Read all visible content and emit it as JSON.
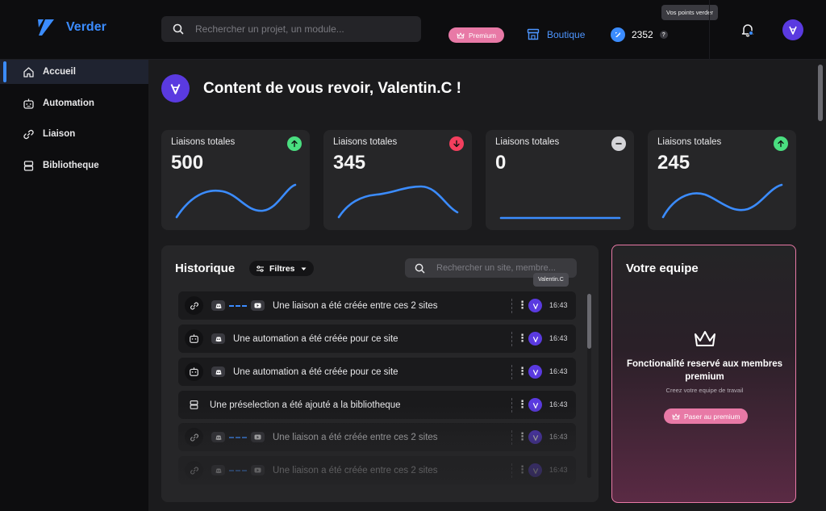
{
  "app": {
    "name": "Verder"
  },
  "header": {
    "search_placeholder": "Rechercher un projet, un module...",
    "premium_label": "Premium",
    "boutique_label": "Boutique",
    "points_value": "2352",
    "points_help": "?",
    "points_tooltip": "Vos points verder"
  },
  "sidebar": {
    "items": [
      {
        "label": "Accueil",
        "icon": "home-icon",
        "active": true
      },
      {
        "label": "Automation",
        "icon": "robot-icon",
        "active": false
      },
      {
        "label": "Liaison",
        "icon": "link-icon",
        "active": false
      },
      {
        "label": "Bibliotheque",
        "icon": "stack-icon",
        "active": false
      }
    ]
  },
  "welcome": {
    "title": "Content de vous revoir, Valentin.C !"
  },
  "cards": [
    {
      "label": "Liaisons totales",
      "value": "500",
      "trend": "up"
    },
    {
      "label": "Liaisons totales",
      "value": "345",
      "trend": "down"
    },
    {
      "label": "Liaisons totales",
      "value": "0",
      "trend": "flat"
    },
    {
      "label": "Liaisons totales",
      "value": "245",
      "trend": "up"
    }
  ],
  "colors": {
    "accent": "#3b8cff",
    "pink": "#e879a6",
    "up": "#4ade80",
    "down": "#f43f5e",
    "flat": "#d4d4d8",
    "avatar": "#5a3ae0"
  },
  "history": {
    "title": "Historique",
    "filter_label": "Filtres",
    "search_placeholder": "Rechercher un site, membre...",
    "user_tooltip": "Valentin.C",
    "rows": [
      {
        "type": "liaison",
        "text": "Une liaison a été créée entre ces 2 sites",
        "time": "16:43"
      },
      {
        "type": "automation",
        "text": "Une automation a été créée pour ce site",
        "time": "16:43"
      },
      {
        "type": "automation",
        "text": "Une automation a été créée pour ce site",
        "time": "16:43"
      },
      {
        "type": "bibliotheque",
        "text": "Une préselection a été ajouté a la bibliotheque",
        "time": "16:43"
      },
      {
        "type": "liaison",
        "text": "Une liaison a été créée entre ces 2 sites",
        "time": "16:43"
      },
      {
        "type": "liaison",
        "text": "Une liaison a été créée entre ces 2 sites",
        "time": "16:43"
      }
    ]
  },
  "team": {
    "title": "Votre equipe",
    "feature": "Fonctionalité reservé aux membres premium",
    "subtitle": "Creez votre equipe de travail",
    "button_label": "Paser au premium"
  }
}
